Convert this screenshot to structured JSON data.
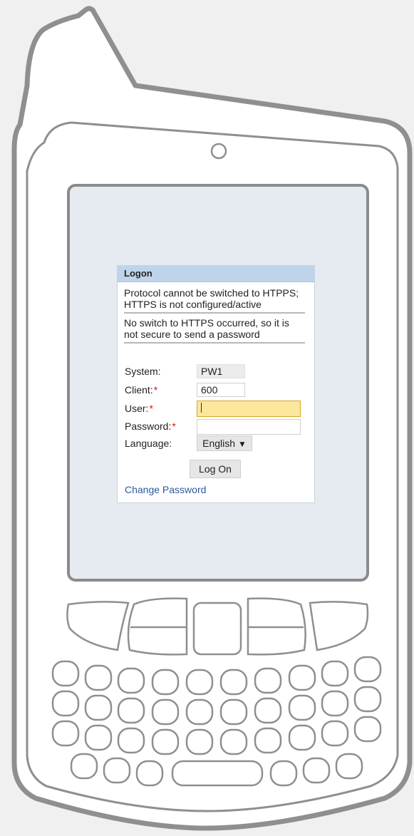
{
  "logon": {
    "title": "Logon",
    "messages": [
      "Protocol cannot be switched to HTPPS; HTTPS is not configured/active",
      "No switch to HTTPS occurred, so it is not secure to send a password"
    ],
    "fields": {
      "system": {
        "label": "System:",
        "value": "PW1"
      },
      "client": {
        "label": "Client:",
        "value": "600",
        "required_mark": "*"
      },
      "user": {
        "label": "User:",
        "value": "",
        "required_mark": "*"
      },
      "password": {
        "label": "Password:",
        "value": "",
        "required_mark": "*"
      },
      "language": {
        "label": "Language:",
        "value": "English",
        "arrow": "▼"
      }
    },
    "log_on_button": "Log On",
    "change_password_link": "Change Password"
  },
  "colors": {
    "header_bg": "#bfd4ea",
    "active_field_bg": "#fde79d",
    "required": "#dd1111",
    "link": "#2b5a9b",
    "screen_bg": "#e6ebf1"
  },
  "icons": [
    "dropdown-arrow-icon",
    "camera-icon"
  ]
}
